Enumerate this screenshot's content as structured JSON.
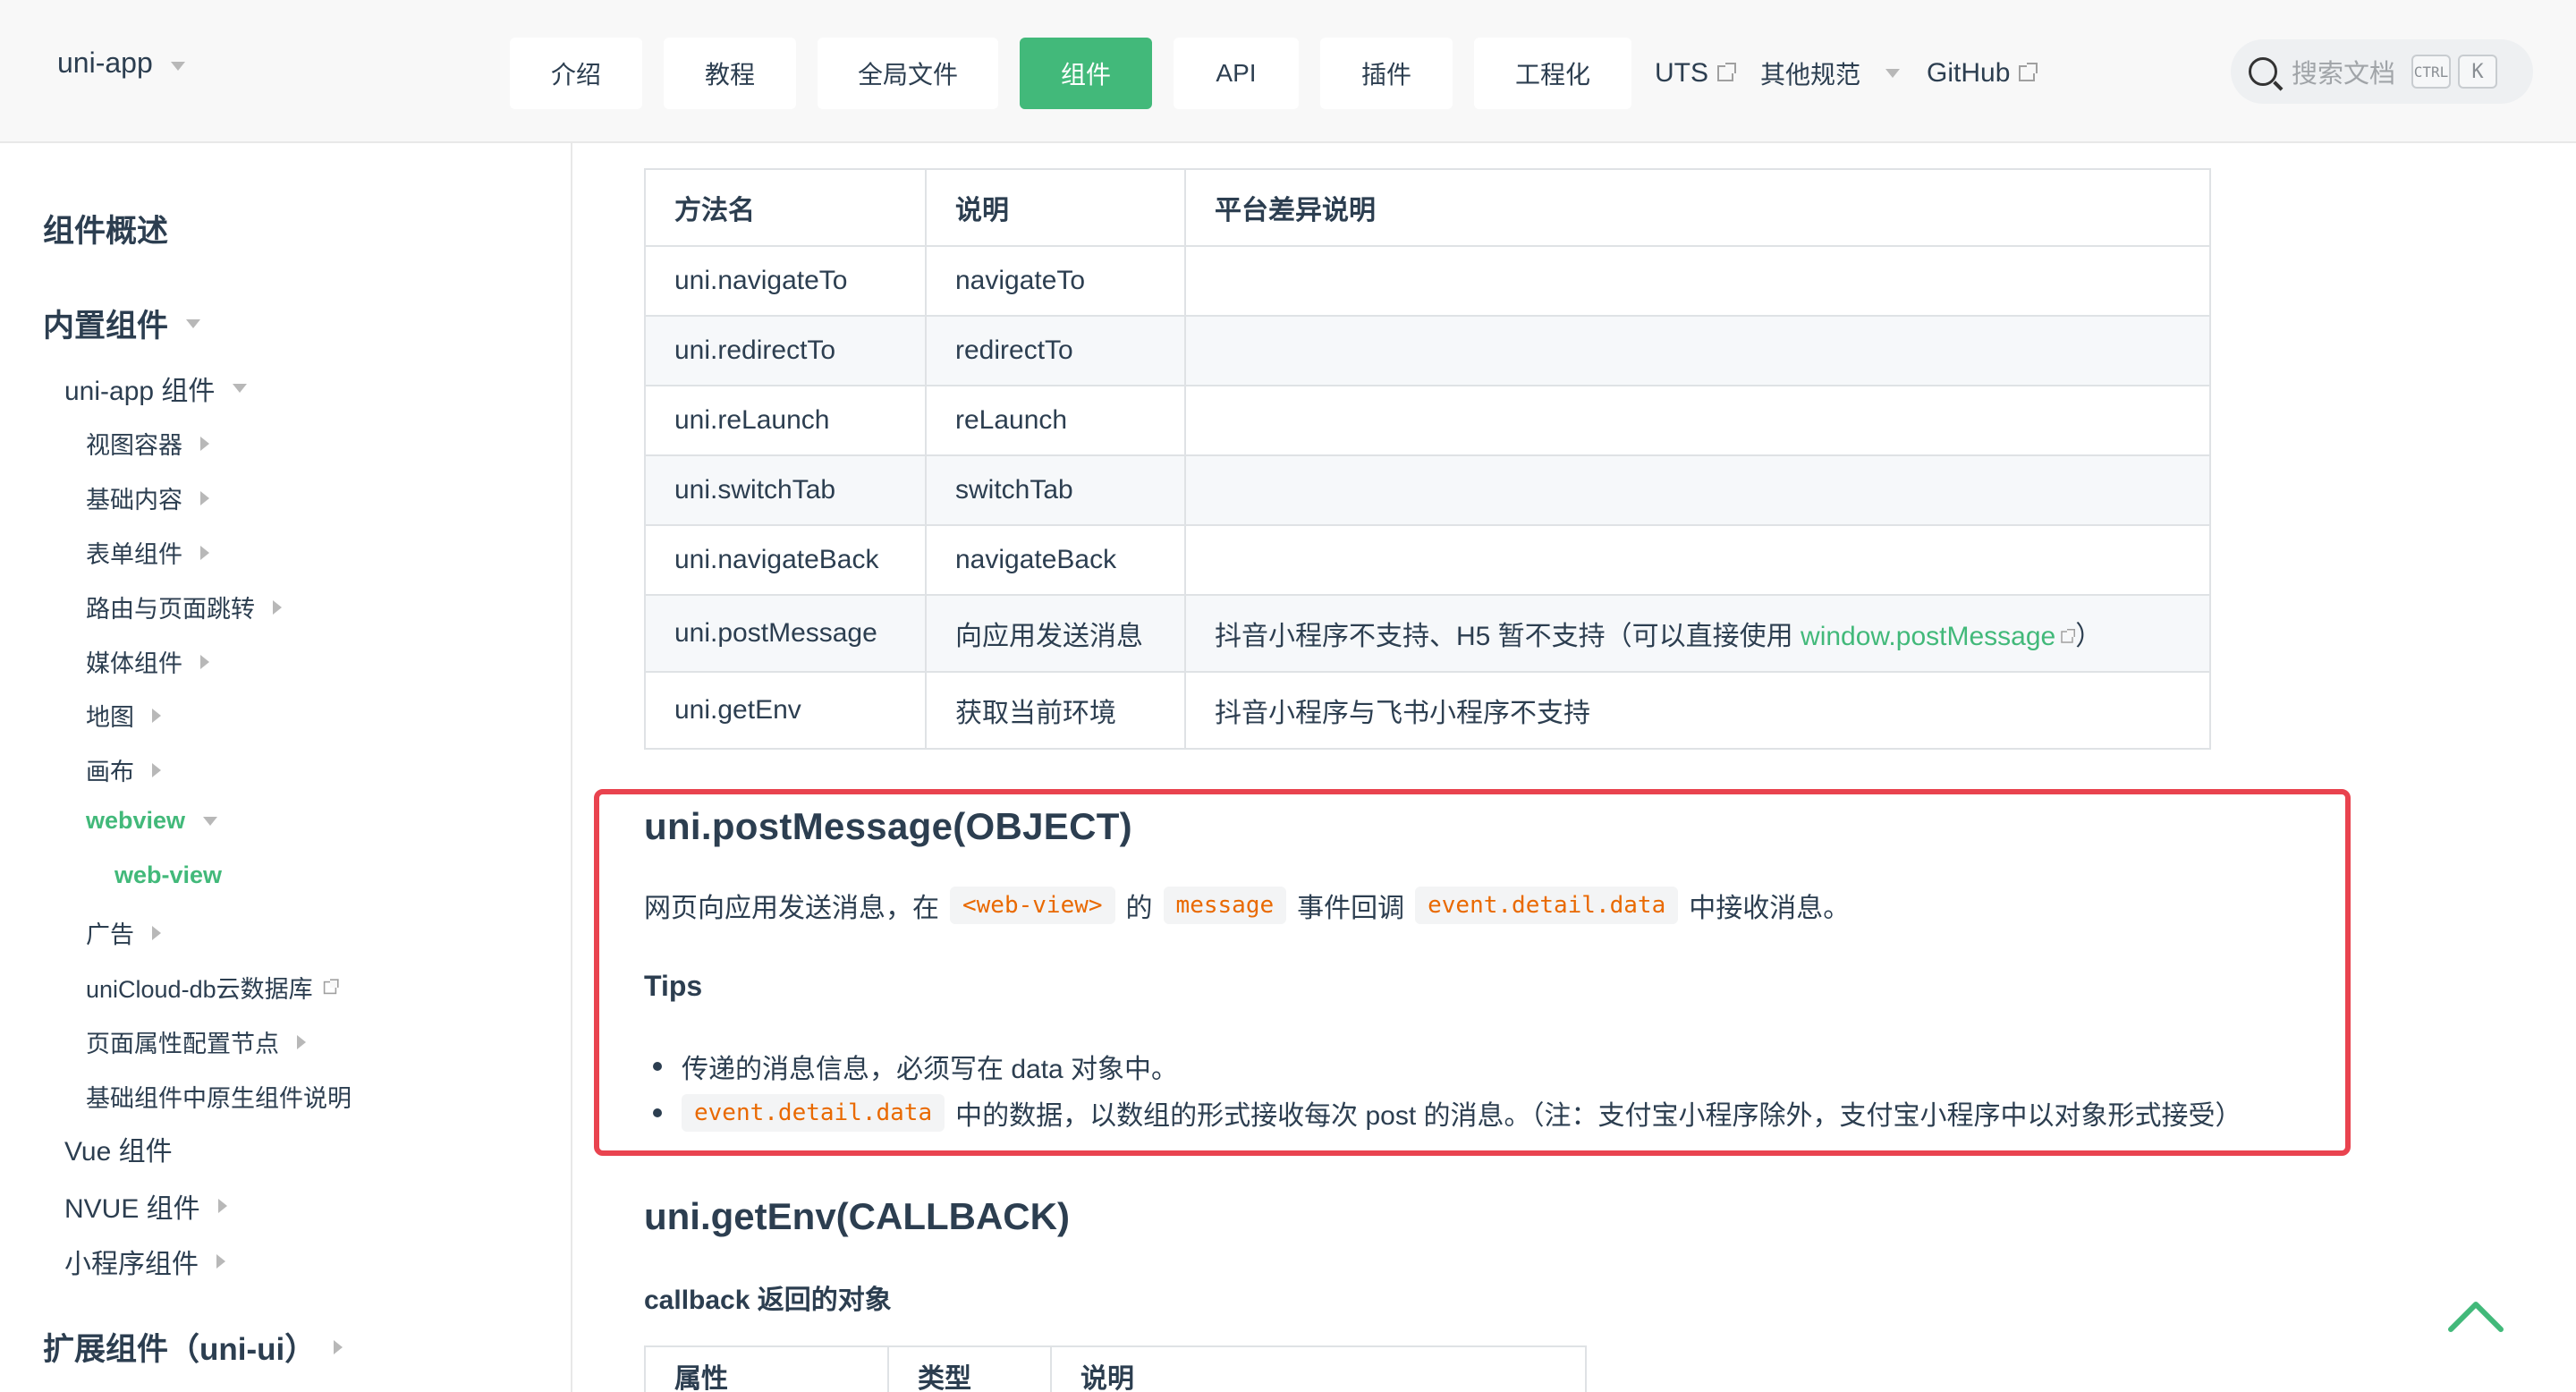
{
  "header": {
    "brand": "uni-app",
    "nav": [
      {
        "label": "介绍",
        "active": false
      },
      {
        "label": "教程",
        "active": false
      },
      {
        "label": "全局文件",
        "active": false
      },
      {
        "label": "组件",
        "active": true
      },
      {
        "label": "API",
        "active": false
      },
      {
        "label": "插件",
        "active": false
      },
      {
        "label": "工程化",
        "active": false
      }
    ],
    "links": {
      "uts": "UTS",
      "other": "其他规范",
      "github": "GitHub"
    },
    "search": {
      "placeholder": "搜索文档",
      "key1": "CTRL",
      "key2": "K"
    }
  },
  "sidebar": {
    "overview": "组件概述",
    "builtin": "内置组件",
    "uniapp_components": "uni-app 组件",
    "items": [
      "视图容器",
      "基础内容",
      "表单组件",
      "路由与页面跳转",
      "媒体组件",
      "地图",
      "画布"
    ],
    "webview": "webview",
    "webview_child": "web-view",
    "ad": "广告",
    "unicloud": "uniCloud-db云数据库",
    "page_props": "页面属性配置节点",
    "native_desc": "基础组件中原生组件说明",
    "vue": "Vue 组件",
    "nvue": "NVUE 组件",
    "mp": "小程序组件",
    "ext": "扩展组件（uni-ui）"
  },
  "methods_table": {
    "headers": [
      "方法名",
      "说明",
      "平台差异说明"
    ],
    "rows": [
      {
        "name": "uni.navigateTo",
        "desc": "navigateTo",
        "platform": ""
      },
      {
        "name": "uni.redirectTo",
        "desc": "redirectTo",
        "platform": ""
      },
      {
        "name": "uni.reLaunch",
        "desc": "reLaunch",
        "platform": ""
      },
      {
        "name": "uni.switchTab",
        "desc": "switchTab",
        "platform": ""
      },
      {
        "name": "uni.navigateBack",
        "desc": "navigateBack",
        "platform": ""
      },
      {
        "name": "uni.postMessage",
        "desc": "向应用发送消息",
        "platform_pre": "抖音小程序不支持、H5 暂不支持（可以直接使用 ",
        "platform_link": "window.postMessage",
        "platform_post": "）"
      },
      {
        "name": "uni.getEnv",
        "desc": "获取当前环境",
        "platform": "抖音小程序与飞书小程序不支持"
      }
    ]
  },
  "post_message": {
    "title": "uni.postMessage(OBJECT)",
    "desc_1": "网页向应用发送消息，在",
    "code_1": "<web-view>",
    "desc_2": "的",
    "code_2": "message",
    "desc_3": "事件回调",
    "code_3": "event.detail.data",
    "desc_4": "中接收消息。",
    "tips_title": "Tips",
    "tip_1": "传递的消息信息，必须写在 data 对象中。",
    "tip_2_code": "event.detail.data",
    "tip_2_text": "中的数据，以数组的形式接收每次 post 的消息。（注：支付宝小程序除外，支付宝小程序中以对象形式接受）"
  },
  "get_env": {
    "title": "uni.getEnv(CALLBACK)",
    "subtitle": "callback 返回的对象",
    "headers": [
      "属性",
      "类型",
      "说明"
    ]
  },
  "colors": {
    "accent": "#42b97a",
    "highlight_border": "#e9434f",
    "code": "#e96900"
  }
}
